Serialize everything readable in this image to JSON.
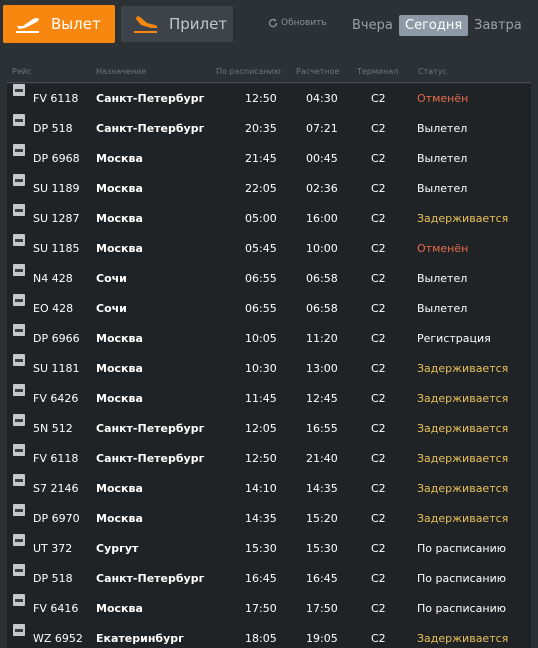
{
  "tabs": {
    "departures": {
      "label": "Вылет",
      "icon": "plane-takeoff-icon"
    },
    "arrivals": {
      "label": "Прилет",
      "icon": "plane-landing-icon"
    }
  },
  "refresh": {
    "label": "Обновить",
    "icon": "refresh-icon"
  },
  "days": {
    "yesterday": "Вчера",
    "today": "Сегодня",
    "tomorrow": "Завтра",
    "selected": "today"
  },
  "columns": {
    "flight": "Рейс",
    "destination": "Назначение",
    "scheduled": "По расписанию",
    "estimated": "Расчетное",
    "terminal": "Терминал",
    "status": "Статус"
  },
  "colors": {
    "accent": "#f7870f",
    "cancelled": "#e86a4a",
    "delayed": "#e8c15a"
  },
  "flights": [
    {
      "flight": "FV 6118",
      "destination": "Санкт-Петербург",
      "scheduled": "12:50",
      "estimated": "04:30",
      "terminal": "C2",
      "status": "Отменён",
      "status_type": "cancelled"
    },
    {
      "flight": "DP 518",
      "destination": "Санкт-Петербург",
      "scheduled": "20:35",
      "estimated": "07:21",
      "terminal": "C2",
      "status": "Вылетел",
      "status_type": "normal"
    },
    {
      "flight": "DP 6968",
      "destination": "Москва",
      "scheduled": "21:45",
      "estimated": "00:45",
      "terminal": "C2",
      "status": "Вылетел",
      "status_type": "normal"
    },
    {
      "flight": "SU 1189",
      "destination": "Москва",
      "scheduled": "22:05",
      "estimated": "02:36",
      "terminal": "C2",
      "status": "Вылетел",
      "status_type": "normal"
    },
    {
      "flight": "SU 1287",
      "destination": "Москва",
      "scheduled": "05:00",
      "estimated": "16:00",
      "terminal": "C2",
      "status": "Задерживается",
      "status_type": "delayed"
    },
    {
      "flight": "SU 1185",
      "destination": "Москва",
      "scheduled": "05:45",
      "estimated": "10:00",
      "terminal": "C2",
      "status": "Отменён",
      "status_type": "cancelled"
    },
    {
      "flight": "N4 428",
      "destination": "Сочи",
      "scheduled": "06:55",
      "estimated": "06:58",
      "terminal": "C2",
      "status": "Вылетел",
      "status_type": "normal"
    },
    {
      "flight": "EO 428",
      "destination": "Сочи",
      "scheduled": "06:55",
      "estimated": "06:58",
      "terminal": "C2",
      "status": "Вылетел",
      "status_type": "normal"
    },
    {
      "flight": "DP 6966",
      "destination": "Москва",
      "scheduled": "10:05",
      "estimated": "11:20",
      "terminal": "C2",
      "status": "Регистрация",
      "status_type": "normal"
    },
    {
      "flight": "SU 1181",
      "destination": "Москва",
      "scheduled": "10:30",
      "estimated": "13:00",
      "terminal": "C2",
      "status": "Задерживается",
      "status_type": "delayed"
    },
    {
      "flight": "FV 6426",
      "destination": "Москва",
      "scheduled": "11:45",
      "estimated": "12:45",
      "terminal": "C2",
      "status": "Задерживается",
      "status_type": "delayed"
    },
    {
      "flight": "5N 512",
      "destination": "Санкт-Петербург",
      "scheduled": "12:05",
      "estimated": "16:55",
      "terminal": "C2",
      "status": "Задерживается",
      "status_type": "delayed"
    },
    {
      "flight": "FV 6118",
      "destination": "Санкт-Петербург",
      "scheduled": "12:50",
      "estimated": "21:40",
      "terminal": "C2",
      "status": "Задерживается",
      "status_type": "delayed"
    },
    {
      "flight": "S7 2146",
      "destination": "Москва",
      "scheduled": "14:10",
      "estimated": "14:35",
      "terminal": "C2",
      "status": "Задерживается",
      "status_type": "delayed"
    },
    {
      "flight": "DP 6970",
      "destination": "Москва",
      "scheduled": "14:35",
      "estimated": "15:20",
      "terminal": "C2",
      "status": "Задерживается",
      "status_type": "delayed"
    },
    {
      "flight": "UT 372",
      "destination": "Сургут",
      "scheduled": "15:30",
      "estimated": "15:30",
      "terminal": "C2",
      "status": "По расписанию",
      "status_type": "normal"
    },
    {
      "flight": "DP 518",
      "destination": "Санкт-Петербург",
      "scheduled": "16:45",
      "estimated": "16:45",
      "terminal": "C2",
      "status": "По расписанию",
      "status_type": "normal"
    },
    {
      "flight": "FV 6416",
      "destination": "Москва",
      "scheduled": "17:50",
      "estimated": "17:50",
      "terminal": "C2",
      "status": "По расписанию",
      "status_type": "normal"
    },
    {
      "flight": "WZ 6952",
      "destination": "Екатеринбург",
      "scheduled": "18:05",
      "estimated": "19:05",
      "terminal": "C2",
      "status": "Задерживается",
      "status_type": "delayed"
    }
  ]
}
